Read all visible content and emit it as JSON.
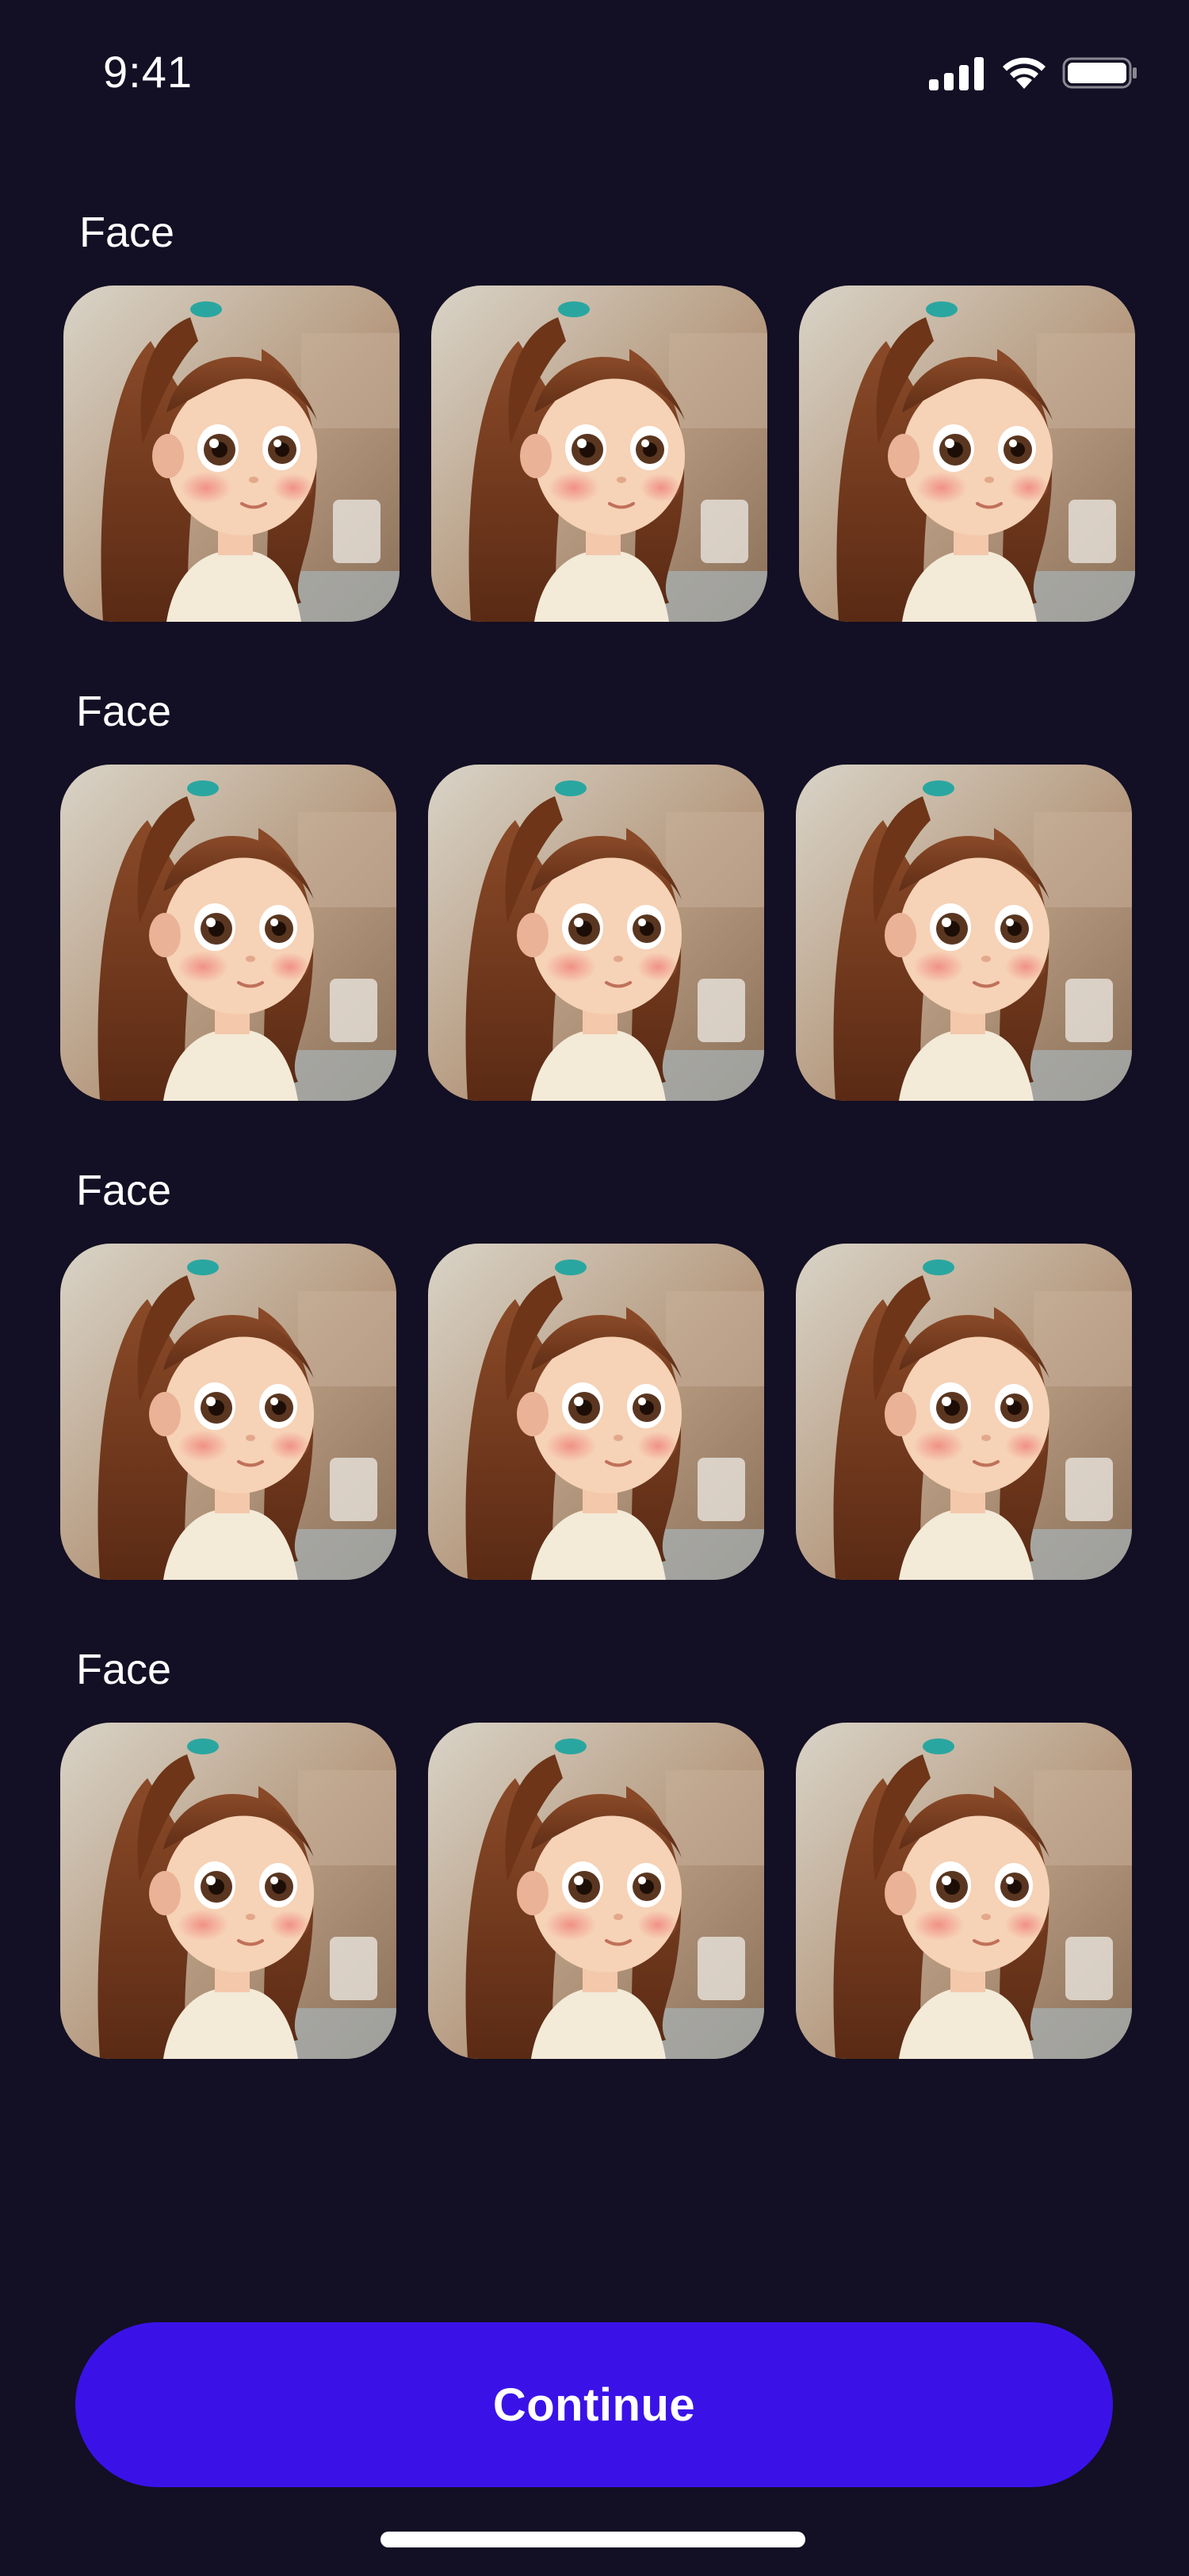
{
  "status_bar": {
    "time": "9:41",
    "icons": [
      "cellular-signal-icon",
      "wifi-icon",
      "battery-icon"
    ]
  },
  "sections": [
    {
      "label": "Face",
      "thumbnails": [
        "cartoon-girl-portrait",
        "cartoon-girl-portrait",
        "cartoon-girl-portrait"
      ]
    },
    {
      "label": "Face",
      "thumbnails": [
        "cartoon-girl-portrait",
        "cartoon-girl-portrait",
        "cartoon-girl-portrait"
      ]
    },
    {
      "label": "Face",
      "thumbnails": [
        "cartoon-girl-portrait",
        "cartoon-girl-portrait",
        "cartoon-girl-portrait"
      ]
    },
    {
      "label": "Face",
      "thumbnails": [
        "cartoon-girl-portrait",
        "cartoon-girl-portrait",
        "cartoon-girl-portrait"
      ]
    }
  ],
  "footer": {
    "continue_label": "Continue"
  },
  "colors": {
    "background": "#130f24",
    "accent": "#3a12e8",
    "text": "#ffffff"
  }
}
